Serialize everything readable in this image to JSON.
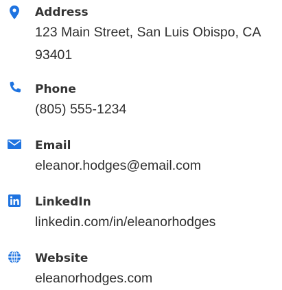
{
  "colors": {
    "accent": "#1e73e0",
    "label": "#333333",
    "value": "#2f2f2f"
  },
  "contact": {
    "address": {
      "icon": "map-pin-icon",
      "label": "Address",
      "value": "123 Main Street, San Luis Obispo, CA 93401"
    },
    "phone": {
      "icon": "phone-icon",
      "label": "Phone",
      "value": "(805) 555-1234"
    },
    "email": {
      "icon": "envelope-icon",
      "label": "Email",
      "value": "eleanor.hodges@email.com"
    },
    "linkedin": {
      "icon": "linkedin-icon",
      "label": "LinkedIn",
      "value": "linkedin.com/in/eleanorhodges"
    },
    "website": {
      "icon": "globe-icon",
      "label": "Website",
      "value": "eleanorhodges.com"
    }
  }
}
